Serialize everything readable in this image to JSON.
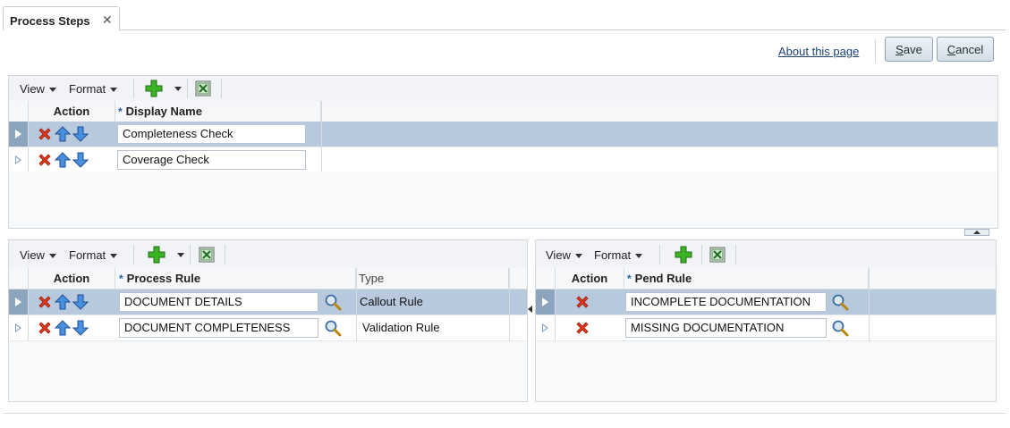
{
  "tab": {
    "label": "Process Steps",
    "close": "✕"
  },
  "header": {
    "about_link": "About this page",
    "save_mnemonic": "S",
    "save_rest": "ave",
    "cancel_mnemonic": "C",
    "cancel_rest": "ancel"
  },
  "toolbar_labels": {
    "view": "View",
    "format": "Format"
  },
  "steps_table": {
    "columns": {
      "action": "Action",
      "display_name": "Display Name"
    },
    "rows": [
      {
        "display_name": "Completeness Check",
        "selected": true
      },
      {
        "display_name": "Coverage Check",
        "selected": false
      }
    ]
  },
  "rules_table": {
    "columns": {
      "action": "Action",
      "process_rule": "Process Rule",
      "type": "Type"
    },
    "rows": [
      {
        "process_rule": "DOCUMENT DETAILS",
        "type": "Callout Rule",
        "selected": true
      },
      {
        "process_rule": "DOCUMENT COMPLETENESS",
        "type": "Validation Rule",
        "selected": false
      }
    ]
  },
  "pend_table": {
    "columns": {
      "action": "Action",
      "pend_rule": "Pend Rule"
    },
    "rows": [
      {
        "pend_rule": "INCOMPLETE DOCUMENTATION",
        "selected": true
      },
      {
        "pend_rule": "MISSING DOCUMENTATION",
        "selected": false
      }
    ]
  },
  "colors": {
    "selected_row": "#b8c9de",
    "link": "#1a3f7a",
    "required_marker": "#1f5fa6"
  },
  "icons": [
    "delete-x-icon",
    "move-up-arrow-icon",
    "move-down-arrow-icon",
    "add-plus-icon",
    "export-excel-icon",
    "search-magnifier-icon"
  ]
}
